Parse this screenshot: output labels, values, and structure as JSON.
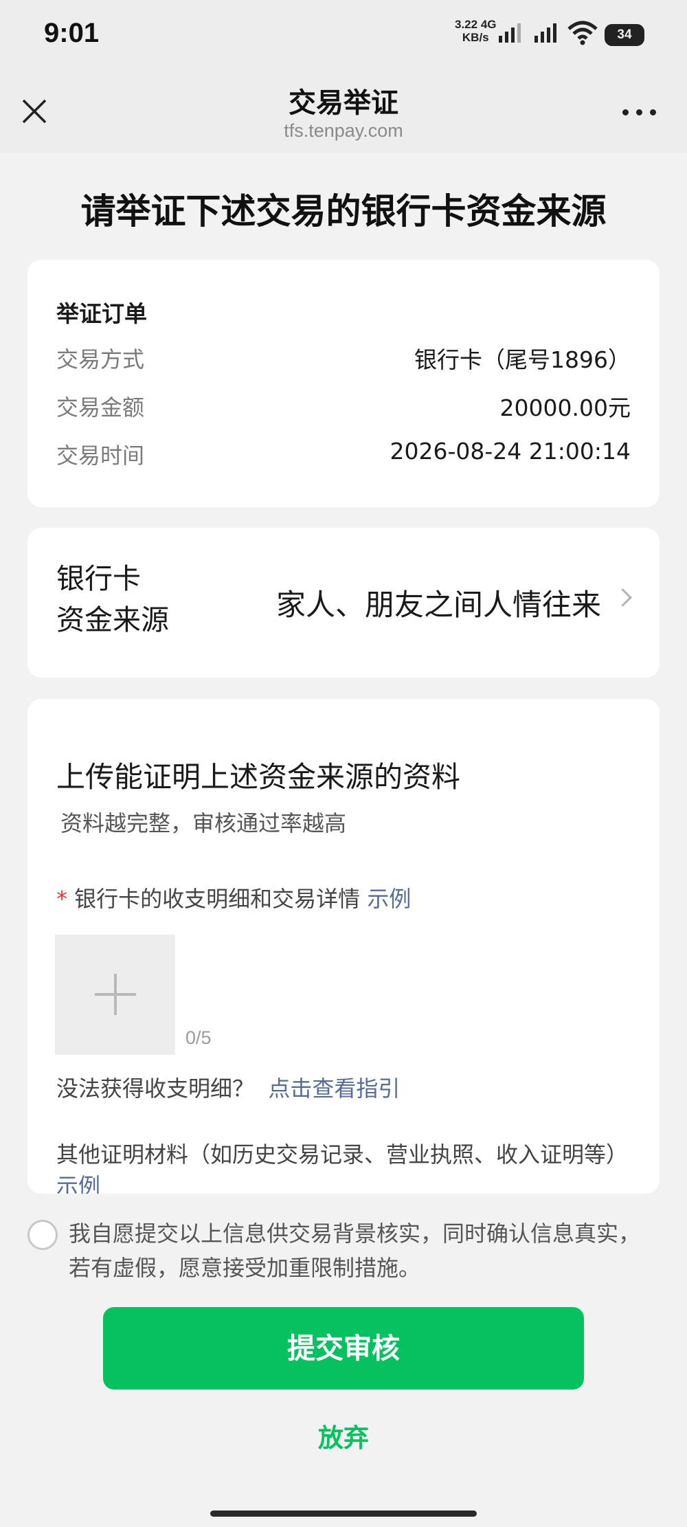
{
  "status_bar": {
    "time": "9:01",
    "net_speed_value": "3.22",
    "net_speed_unit": "KB/s",
    "network_type": "4G",
    "battery": "34"
  },
  "nav": {
    "title": "交易举证",
    "domain": "tfs.tenpay.com",
    "close_icon": "close-icon",
    "more_icon": "more-icon"
  },
  "page_title": "请举证下述交易的银行卡资金来源",
  "order": {
    "heading": "举证订单",
    "rows": [
      {
        "label": "交易方式",
        "value": "银行卡（尾号1896）"
      },
      {
        "label": "交易金额",
        "value": "20000.00元"
      },
      {
        "label": "交易时间",
        "value": "2026-08-24 21:00:14"
      }
    ]
  },
  "fund_source": {
    "label_line1": "银行卡",
    "label_line2": "资金来源",
    "value": "家人、朋友之间人情往来"
  },
  "upload": {
    "title": "上传能证明上述资金来源的资料",
    "subtitle": "资料越完整，审核通过率越高",
    "required_mark": "*",
    "required_label": "银行卡的收支明细和交易详情",
    "example_link": "示例",
    "count": "0/5",
    "guide_question": "没法获得收支明细？",
    "guide_link": "点击查看指引",
    "other_text": "其他证明材料（如历史交易记录、营业执照、收入证明等）",
    "other_example_link": "示例"
  },
  "agreement": {
    "text": "我自愿提交以上信息供交易背景核实，同时确认信息真实，若有虚假，愿意接受加重限制措施。",
    "checked": false
  },
  "buttons": {
    "submit": "提交审核",
    "give_up": "放弃"
  },
  "colors": {
    "primary_green": "#07c160",
    "link_blue": "#576b95",
    "required_red": "#e53935",
    "background": "#f2f2f2"
  }
}
